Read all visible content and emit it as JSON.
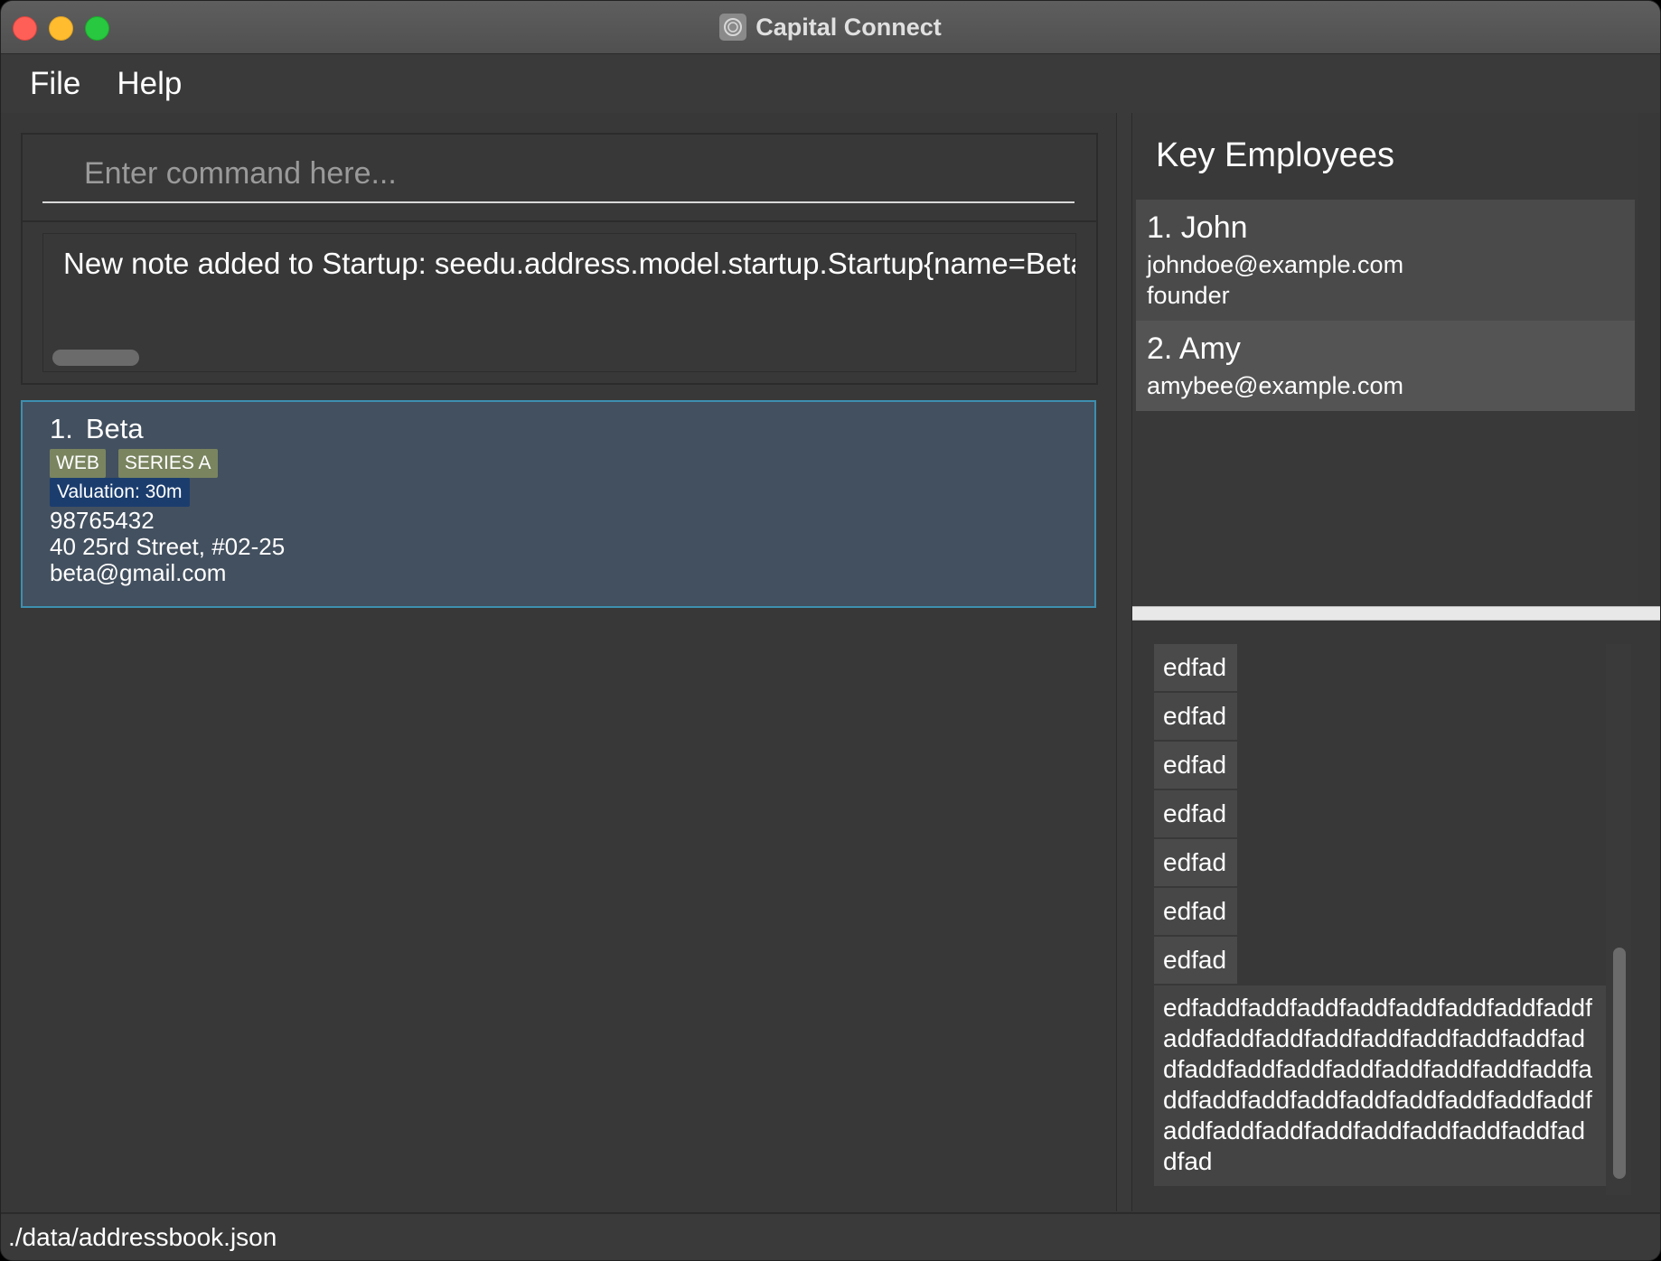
{
  "window": {
    "title": "Capital Connect"
  },
  "menu": {
    "items": [
      "File",
      "Help"
    ]
  },
  "command": {
    "placeholder": "Enter command here...",
    "value": ""
  },
  "result": {
    "text": "New note added to Startup: seedu.address.model.startup.Startup{name=Beta"
  },
  "startups": [
    {
      "index": "1.",
      "name": "Beta",
      "tags": [
        "WEB",
        "SERIES A"
      ],
      "valuation": "Valuation: 30m",
      "phone": "98765432",
      "address": "40 25rd Street, #02-25",
      "email": "beta@gmail.com"
    }
  ],
  "key_employees": {
    "title": "Key Employees",
    "employees": [
      {
        "label": "1. John",
        "email": "johndoe@example.com",
        "role": "founder"
      },
      {
        "label": "2. Amy",
        "email": "amybee@example.com",
        "role": ""
      }
    ]
  },
  "notes": {
    "short": [
      "edfad",
      "edfad",
      "edfad",
      "edfad",
      "edfad",
      "edfad",
      "edfad"
    ],
    "long": "edfaddfaddfaddfaddfaddfaddfaddfaddfaddfaddfaddfaddfaddfaddfaddfaddfaddfaddfaddfaddfaddfaddfaddfaddfaddfaddfaddfaddfaddfaddfaddfaddfaddfaddfaddfaddfaddfaddfaddfaddfaddfaddfaddfad"
  },
  "status": {
    "path": "./data/addressbook.json"
  },
  "colors": {
    "window_bg": "#383838",
    "selected_card": "#43505f",
    "selected_border": "#3d8fb0",
    "tag_bg": "#7a8560",
    "valuation_bg": "#1b3d6e"
  }
}
